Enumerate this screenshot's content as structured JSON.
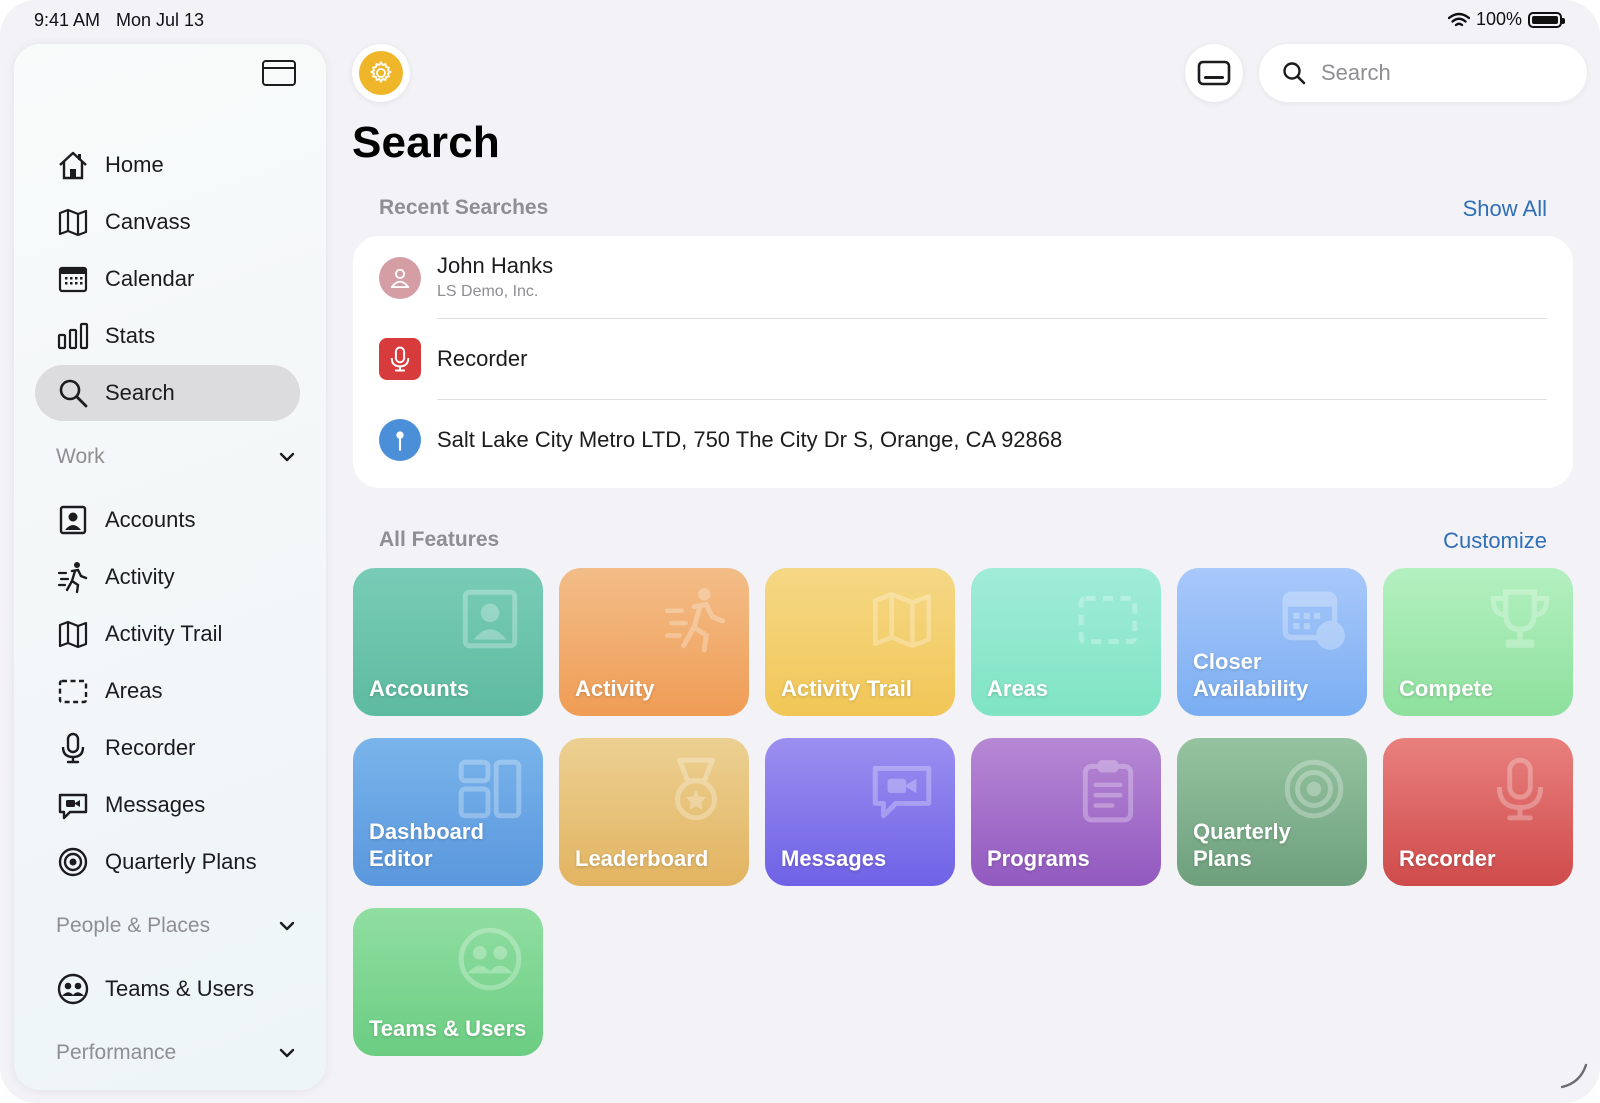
{
  "status_bar": {
    "time": "9:41 AM",
    "date": "Mon Jul 13",
    "battery": "100%"
  },
  "sidebar": {
    "primary": [
      {
        "label": "Home",
        "icon": "home-icon"
      },
      {
        "label": "Canvass",
        "icon": "map-icon"
      },
      {
        "label": "Calendar",
        "icon": "calendar-icon"
      },
      {
        "label": "Stats",
        "icon": "stats-icon"
      },
      {
        "label": "Search",
        "icon": "search-icon",
        "selected": true
      }
    ],
    "sections": [
      {
        "title": "Work",
        "items": [
          {
            "label": "Accounts",
            "icon": "account-icon"
          },
          {
            "label": "Activity",
            "icon": "activity-icon"
          },
          {
            "label": "Activity Trail",
            "icon": "map-icon"
          },
          {
            "label": "Areas",
            "icon": "areas-icon"
          },
          {
            "label": "Recorder",
            "icon": "microphone-icon"
          },
          {
            "label": "Messages",
            "icon": "messages-icon"
          },
          {
            "label": "Quarterly Plans",
            "icon": "target-icon"
          }
        ]
      },
      {
        "title": "People & Places",
        "items": [
          {
            "label": "Teams & Users",
            "icon": "teams-icon"
          }
        ]
      },
      {
        "title": "Performance",
        "items": []
      }
    ]
  },
  "header": {
    "search_placeholder": "Search",
    "page_title": "Search"
  },
  "recent": {
    "title": "Recent Searches",
    "show_all": "Show All",
    "items": [
      {
        "title": "John Hanks",
        "subtitle": "LS Demo, Inc.",
        "icon": "person-icon",
        "color": "#d59ea4"
      },
      {
        "title": "Recorder",
        "subtitle": "",
        "icon": "microphone-icon",
        "color": "#d83b3b"
      },
      {
        "title": "Salt Lake City Metro LTD, 750 The City Dr S, Orange, CA 92868",
        "subtitle": "",
        "icon": "pin-icon",
        "color": "#4a8fd8"
      }
    ]
  },
  "features": {
    "title": "All Features",
    "customize": "Customize",
    "tiles": [
      {
        "label": "Accounts",
        "icon": "account-icon",
        "from": "#79ccb7",
        "to": "#5dbb9f"
      },
      {
        "label": "Activity",
        "icon": "activity-icon",
        "from": "#f2bd88",
        "to": "#f09d55"
      },
      {
        "label": "Activity Trail",
        "icon": "map-icon",
        "from": "#f5d886",
        "to": "#f1c656"
      },
      {
        "label": "Areas",
        "icon": "areas-icon",
        "from": "#a1ecd7",
        "to": "#7fe4c3"
      },
      {
        "label": "Closer\nAvailability",
        "icon": "calendar-clock-icon",
        "from": "#a9c8fa",
        "to": "#7aaef2"
      },
      {
        "label": "Compete",
        "icon": "trophy-icon",
        "from": "#b3f0c0",
        "to": "#8ee09d"
      },
      {
        "label": "Dashboard\nEditor",
        "icon": "dashboard-icon",
        "from": "#79b4eb",
        "to": "#5a97dd"
      },
      {
        "label": "Leaderboard",
        "icon": "medal-icon",
        "from": "#ecd092",
        "to": "#e2b461"
      },
      {
        "label": "Messages",
        "icon": "messages-icon",
        "from": "#9b8ff0",
        "to": "#6f62e6"
      },
      {
        "label": "Programs",
        "icon": "clipboard-icon",
        "from": "#b688d4",
        "to": "#9259c0"
      },
      {
        "label": "Quarterly\nPlans",
        "icon": "target-icon",
        "from": "#95c3a0",
        "to": "#6ea07d"
      },
      {
        "label": "Recorder",
        "icon": "microphone-icon",
        "from": "#e8807e",
        "to": "#cf4b4b"
      },
      {
        "label": "Teams & Users",
        "icon": "teams-icon",
        "from": "#90dea1",
        "to": "#6bcd82"
      }
    ]
  }
}
